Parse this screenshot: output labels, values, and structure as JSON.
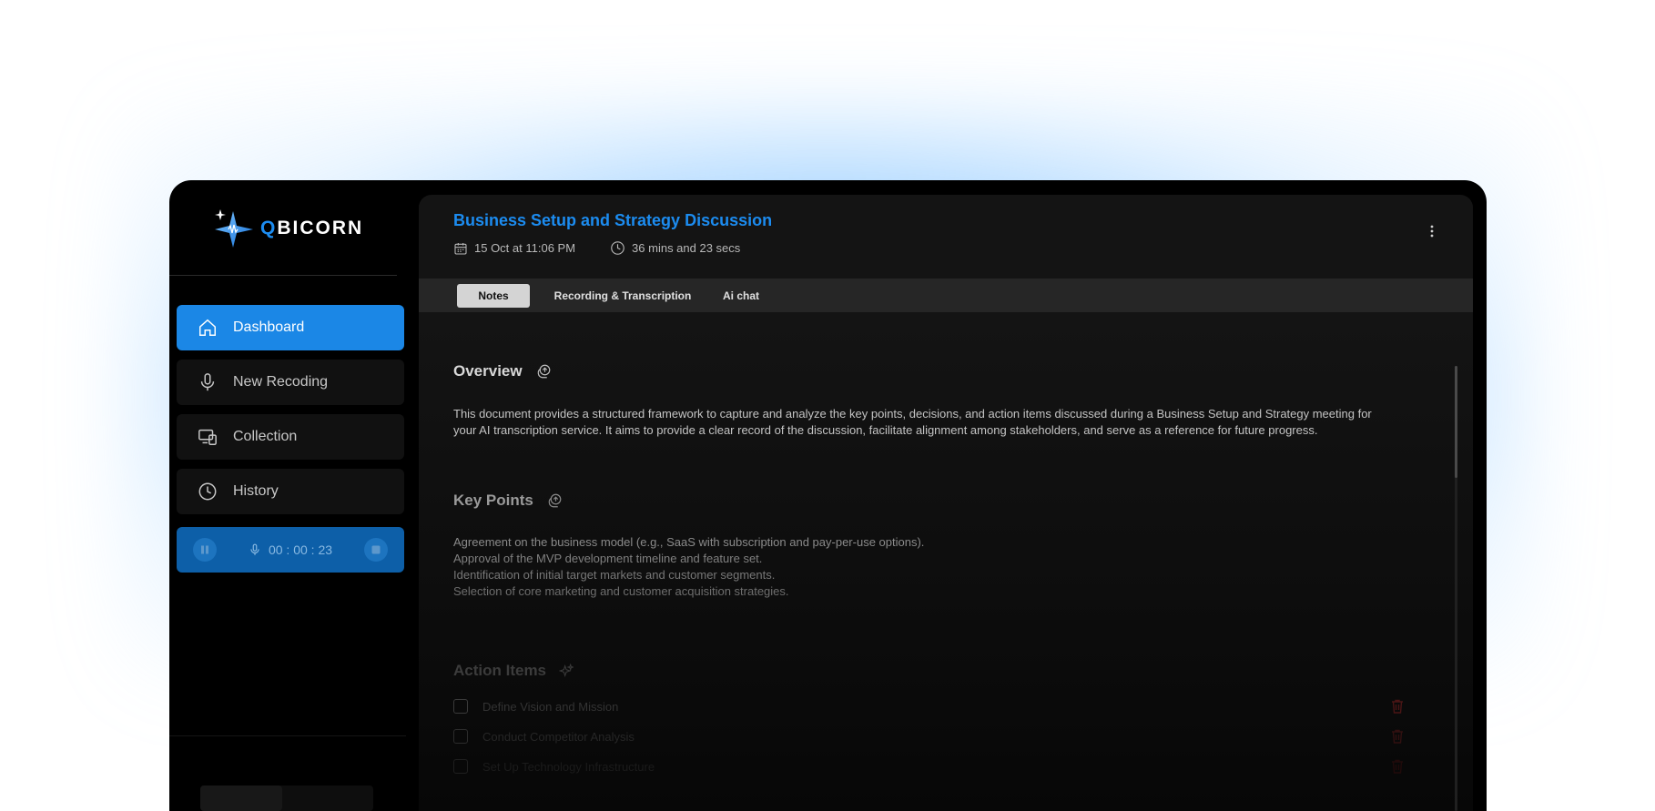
{
  "brand": {
    "logo_q": "Q",
    "logo_rest": "BICORN"
  },
  "sidebar": {
    "items": [
      {
        "label": "Dashboard",
        "icon": "home-icon",
        "active": true
      },
      {
        "label": "New Recoding",
        "icon": "microphone-icon",
        "active": false
      },
      {
        "label": "Collection",
        "icon": "devices-icon",
        "active": false
      },
      {
        "label": "History",
        "icon": "clock-icon",
        "active": false
      }
    ],
    "recorder": {
      "time": "00 : 00 : 23",
      "pause_icon": "pause-icon",
      "mic_icon": "microphone-icon",
      "stop_icon": "stop-icon"
    }
  },
  "header": {
    "title": "Business Setup and Strategy Discussion",
    "date": "15 Oct at 11:06 PM",
    "duration": "36 mins and 23 secs",
    "menu_icon": "kebab-menu-icon"
  },
  "tabs": [
    "Notes",
    "Recording & Transcription",
    "Ai chat"
  ],
  "active_tab": "Notes",
  "notes": {
    "overview": {
      "heading": "Overview",
      "text": "This document provides a structured framework to capture and analyze the key points, decisions, and action items discussed during a Business Setup and Strategy meeting for your AI transcription service. It aims to provide a clear record of the discussion, facilitate alignment among stakeholders, and serve as a reference for future progress."
    },
    "key_points": {
      "heading": "Key Points",
      "items": [
        "Agreement on the business model (e.g., SaaS with subscription and pay-per-use options).",
        "Approval of the MVP development timeline and feature set.",
        "Identification of initial target markets and customer segments.",
        "Selection of core marketing and customer acquisition strategies."
      ]
    },
    "action_items": {
      "heading": "Action Items",
      "items": [
        "Define Vision and Mission",
        "Conduct Competitor Analysis",
        "Set Up Technology Infrastructure"
      ]
    }
  },
  "colors": {
    "accent": "#1b87e6",
    "title": "#1c8cf0",
    "trash": "#e23b3b"
  }
}
